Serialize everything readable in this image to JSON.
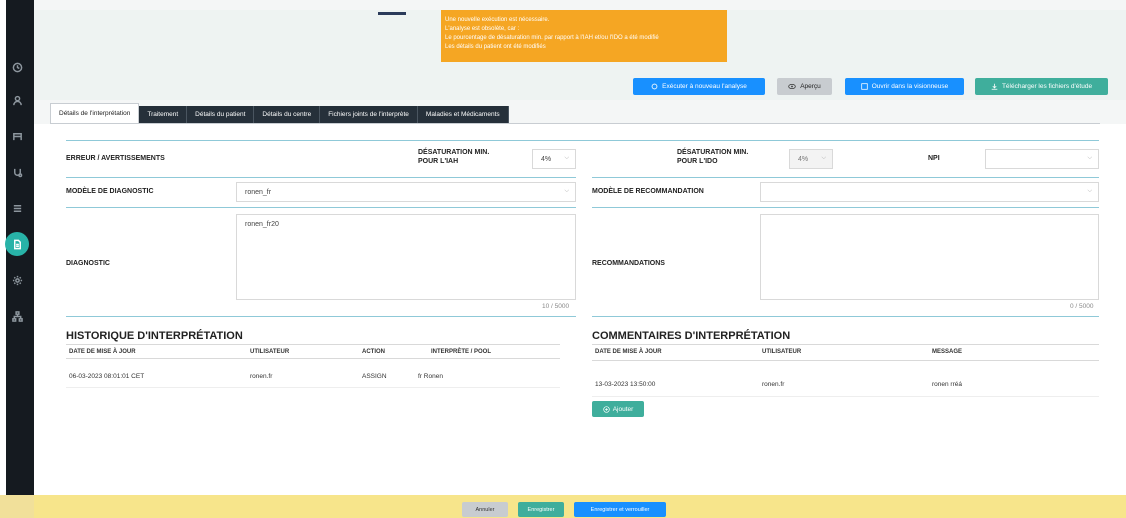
{
  "sidebar": {
    "icons": [
      "clock-icon",
      "user-icon",
      "bed-icon",
      "stethoscope-icon",
      "list-icon",
      "document-icon",
      "settings-icon",
      "network-icon"
    ],
    "accent": "#28b3a8"
  },
  "alert": {
    "line1": "Une nouvelle exécution est nécessaire.",
    "line2": "L'analyse est obsolète, car :",
    "line3": "Le pourcentage de désaturation min. par rapport à l'IAH et/ou l'IDO a été modifié",
    "line4": "Les détails du patient ont été modifiés",
    "color": "#f5a623"
  },
  "actions": {
    "rerun": "Exécuter à nouveau l'analyse",
    "preview": "Aperçu",
    "open_viewer": "Ouvrir dans la visionneuse",
    "download": "Télécharger les fichiers d'étude"
  },
  "tabs": [
    {
      "label": "Détails de l'interprétation"
    },
    {
      "label": "Traitement"
    },
    {
      "label": "Détails du patient"
    },
    {
      "label": "Détails du centre"
    },
    {
      "label": "Fichiers joints de l'interprète"
    },
    {
      "label": "Maladies et Médicaments"
    }
  ],
  "form": {
    "errors_label": "ERREUR / AVERTISSEMENTS",
    "desat_iah_label_1": "DÉSATURATION MIN.",
    "desat_iah_label_2": "POUR L'IAH",
    "desat_iah_value": "4%",
    "desat_ido_label_1": "DÉSATURATION MIN.",
    "desat_ido_label_2": "POUR L'IDO",
    "desat_ido_value": "4%",
    "npi_label": "NPI",
    "npi_value": "",
    "diag_model_label": "MODÈLE DE DIAGNOSTIC",
    "diag_model_value": "ronen_fr",
    "reco_model_label": "MODÈLE DE RECOMMANDATION",
    "reco_model_value": "",
    "diagnostic_label": "DIAGNOSTIC",
    "diagnostic_value": "ronen_fr20",
    "diagnostic_count": "10 / 5000",
    "reco_label": "RECOMMANDATIONS",
    "reco_value": "",
    "reco_count": "0 / 5000"
  },
  "history": {
    "title": "HISTORIQUE D'INTERPRÉTATION",
    "columns": [
      "DATE DE MISE À JOUR",
      "UTILISATEUR",
      "ACTION",
      "INTERPRÈTE / POOL"
    ],
    "rows": [
      [
        "06-03-2023 08:01:01 CET",
        "ronen.fr",
        "ASSIGN",
        "fr Ronen"
      ]
    ]
  },
  "comments": {
    "title": "COMMENTAIRES D'INTERPRÉTATION",
    "columns": [
      "DATE DE MISE À JOUR",
      "UTILISATEUR",
      "MESSAGE"
    ],
    "rows": [
      [
        "13-03-2023 13:50:00",
        "ronen.fr",
        "ronen rréá"
      ]
    ],
    "add_label": "Ajouter"
  },
  "footer": {
    "cancel": "Annuler",
    "save": "Enregistrer",
    "save_lock": "Enregistrer et verrouiller"
  }
}
